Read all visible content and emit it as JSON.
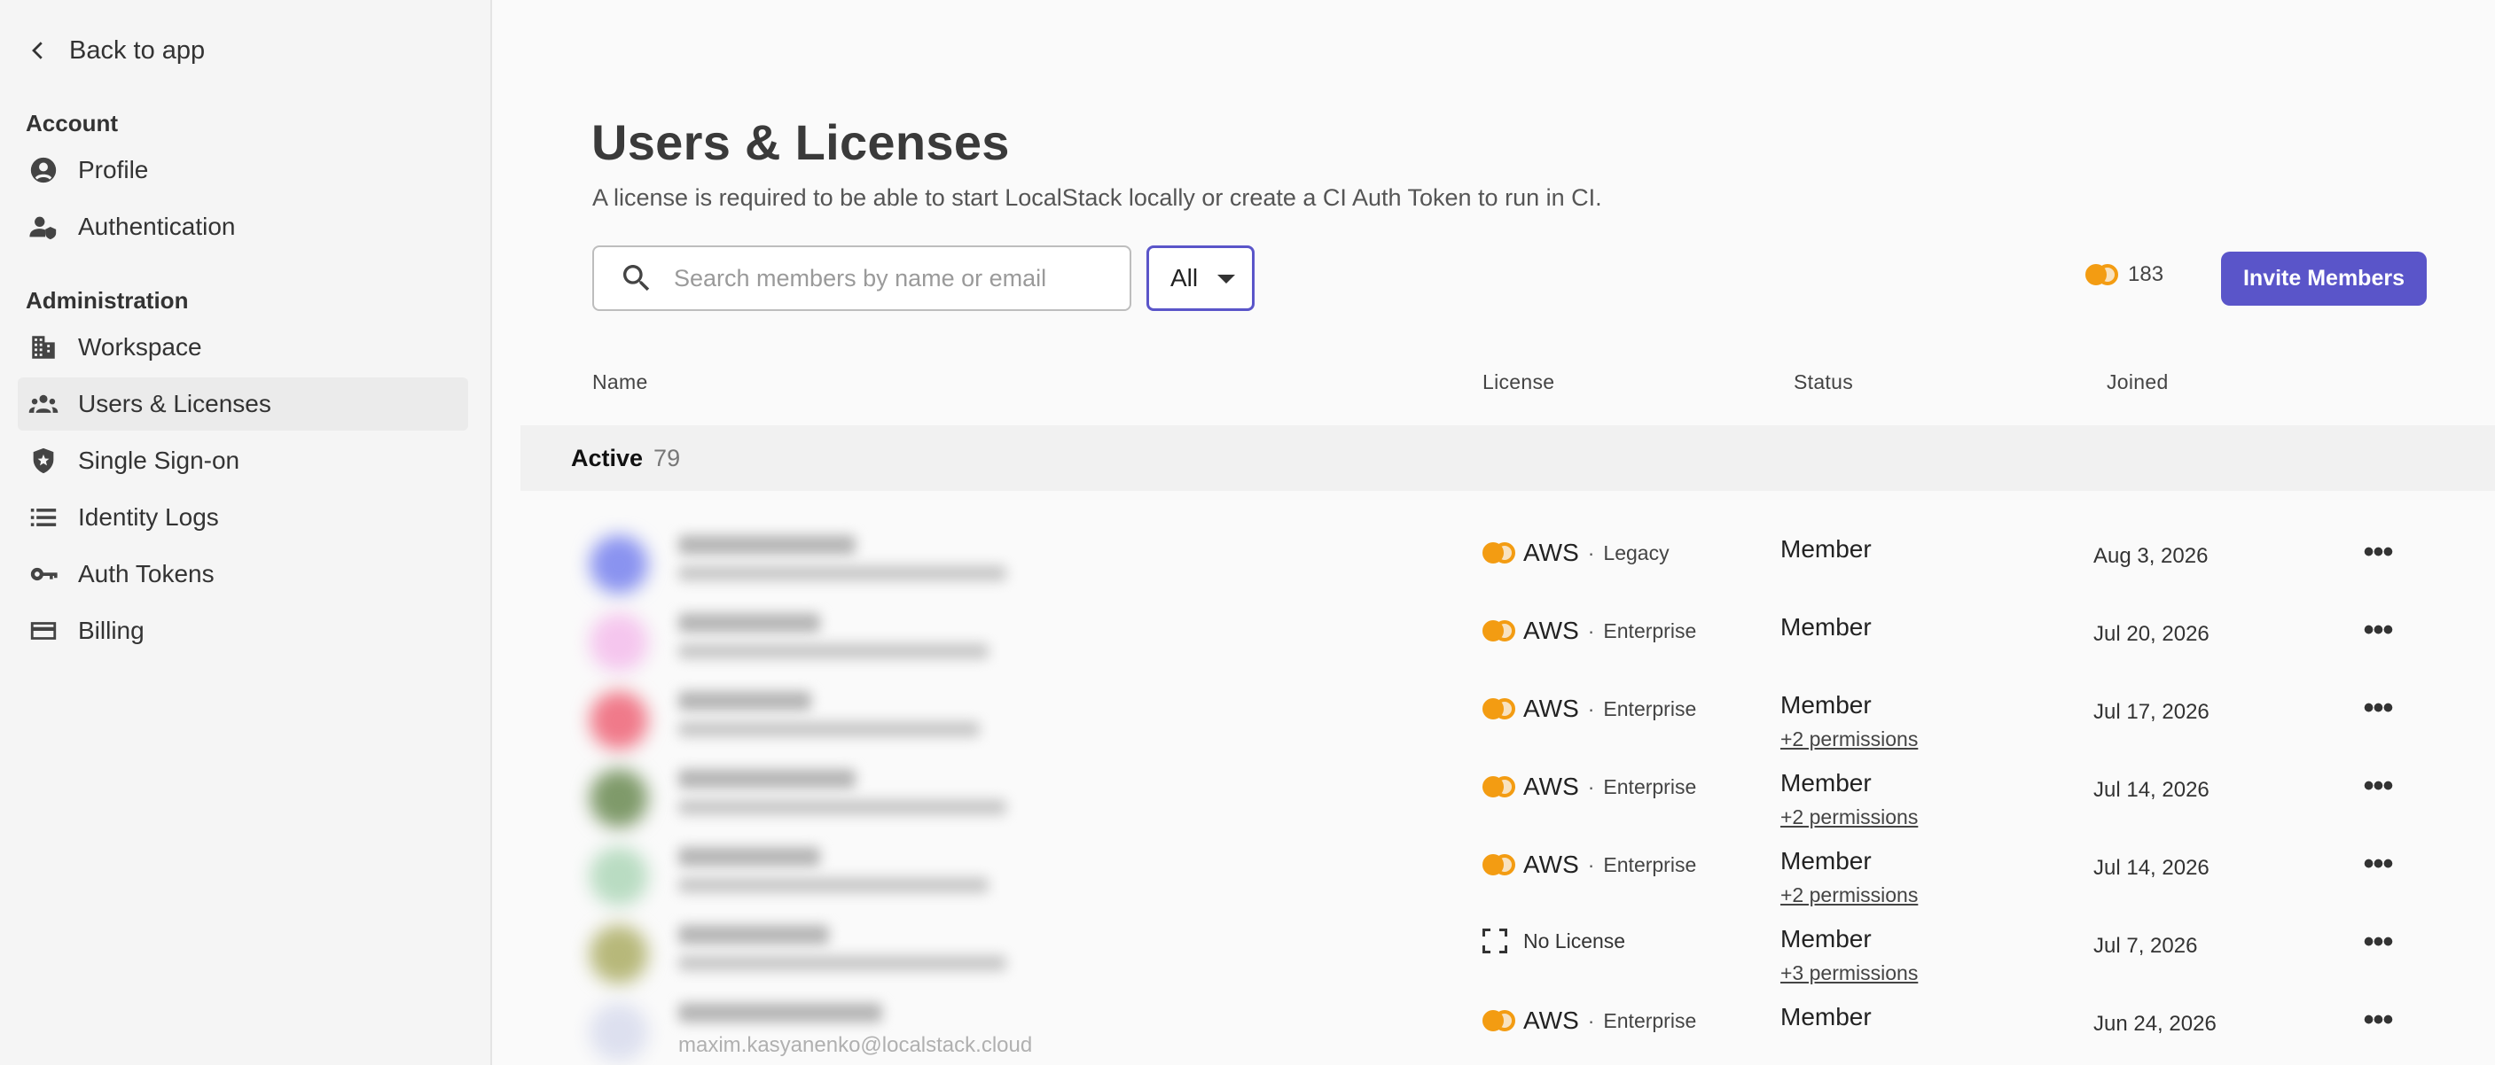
{
  "sidebar": {
    "back_label": "Back to app",
    "account_title": "Account",
    "account_items": [
      {
        "label": "Profile",
        "icon": "profile-icon"
      },
      {
        "label": "Authentication",
        "icon": "authentication-icon"
      }
    ],
    "admin_title": "Administration",
    "admin_items": [
      {
        "label": "Workspace",
        "icon": "building-icon"
      },
      {
        "label": "Users & Licenses",
        "icon": "users-icon",
        "active": true
      },
      {
        "label": "Single Sign-on",
        "icon": "shield-icon"
      },
      {
        "label": "Identity Logs",
        "icon": "list-icon"
      },
      {
        "label": "Auth Tokens",
        "icon": "key-icon"
      },
      {
        "label": "Billing",
        "icon": "credit-card-icon"
      }
    ]
  },
  "header": {
    "title": "Users & Licenses",
    "subtitle": "A license is required to be able to start LocalStack locally or create a CI Auth Token to run in CI."
  },
  "toolbar": {
    "search_placeholder": "Search members by name or email",
    "search_value": "",
    "filter_value": "All",
    "credits": "183",
    "invite_label": "Invite Members"
  },
  "table": {
    "columns": {
      "name": "Name",
      "license": "License",
      "status": "Status",
      "joined": "Joined"
    },
    "group_label": "Active",
    "group_count": "79",
    "rows": [
      {
        "license": "AWS",
        "tier": "Legacy",
        "status": "Member",
        "permissions": "",
        "joined": "Aug 3, 2026"
      },
      {
        "license": "AWS",
        "tier": "Enterprise",
        "status": "Member",
        "permissions": "",
        "joined": "Jul 20, 2026"
      },
      {
        "license": "AWS",
        "tier": "Enterprise",
        "status": "Member",
        "permissions": "+2 permissions",
        "joined": "Jul 17, 2026"
      },
      {
        "license": "AWS",
        "tier": "Enterprise",
        "status": "Member",
        "permissions": "+2 permissions",
        "joined": "Jul 14, 2026"
      },
      {
        "license": "AWS",
        "tier": "Enterprise",
        "status": "Member",
        "permissions": "+2 permissions",
        "joined": "Jul 14, 2026"
      },
      {
        "license": "No License",
        "tier": "",
        "status": "Member",
        "permissions": "+3 permissions",
        "joined": "Jul 7, 2026"
      },
      {
        "license": "AWS",
        "tier": "Enterprise",
        "status": "Member",
        "permissions": "",
        "joined": "Jun 24, 2026",
        "email": "maxim.kasyanenko@localstack.cloud"
      }
    ],
    "separator": "·",
    "more_glyph": "•••"
  },
  "colors": {
    "accent": "#5a55c9",
    "coin": "#f39c12",
    "avatars": [
      "#8a93f0",
      "#f5c6ee",
      "#f07a8a",
      "#7f9a6a",
      "#b9dcc2",
      "#b7b87a",
      "#dde0ef"
    ]
  }
}
